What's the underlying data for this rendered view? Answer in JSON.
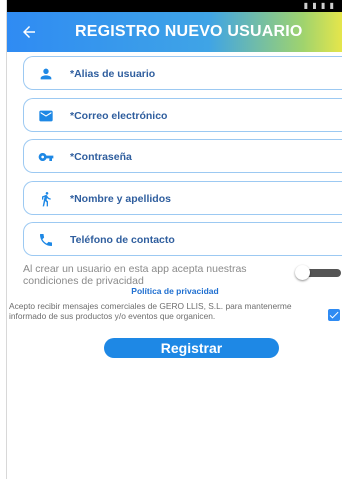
{
  "appbar": {
    "title": "REGISTRO NUEVO USUARIO",
    "back_icon": "arrow-left-icon",
    "gradient_colors": [
      "#2f8bf3",
      "#3fa4e6",
      "#9fd36e",
      "#e7e64a"
    ]
  },
  "form": {
    "fields": [
      {
        "placeholder": "*Alias de usuario",
        "icon": "person-icon"
      },
      {
        "placeholder": "*Correo electrónico",
        "icon": "mail-icon"
      },
      {
        "placeholder": "*Contraseña",
        "icon": "key-icon"
      },
      {
        "placeholder": "*Nombre y apellidos",
        "icon": "walking-person-icon"
      },
      {
        "placeholder": "Teléfono de contacto",
        "icon": "phone-icon"
      }
    ],
    "icon_color": "#1e88e5",
    "field_border_color": "#9cc9f2"
  },
  "consent": {
    "text": "Al crear un usuario en esta app acepta nuestras condiciones de privacidad",
    "toggle_on": false
  },
  "privacy_link": "Política de privacidad",
  "commercial": {
    "text": "Acepto recibir mensajes comerciales de GERO LLIS, S.L. para mantenerme informado de sus productos y/o eventos que organicen.",
    "checked": true
  },
  "submit_label": "Registrar"
}
